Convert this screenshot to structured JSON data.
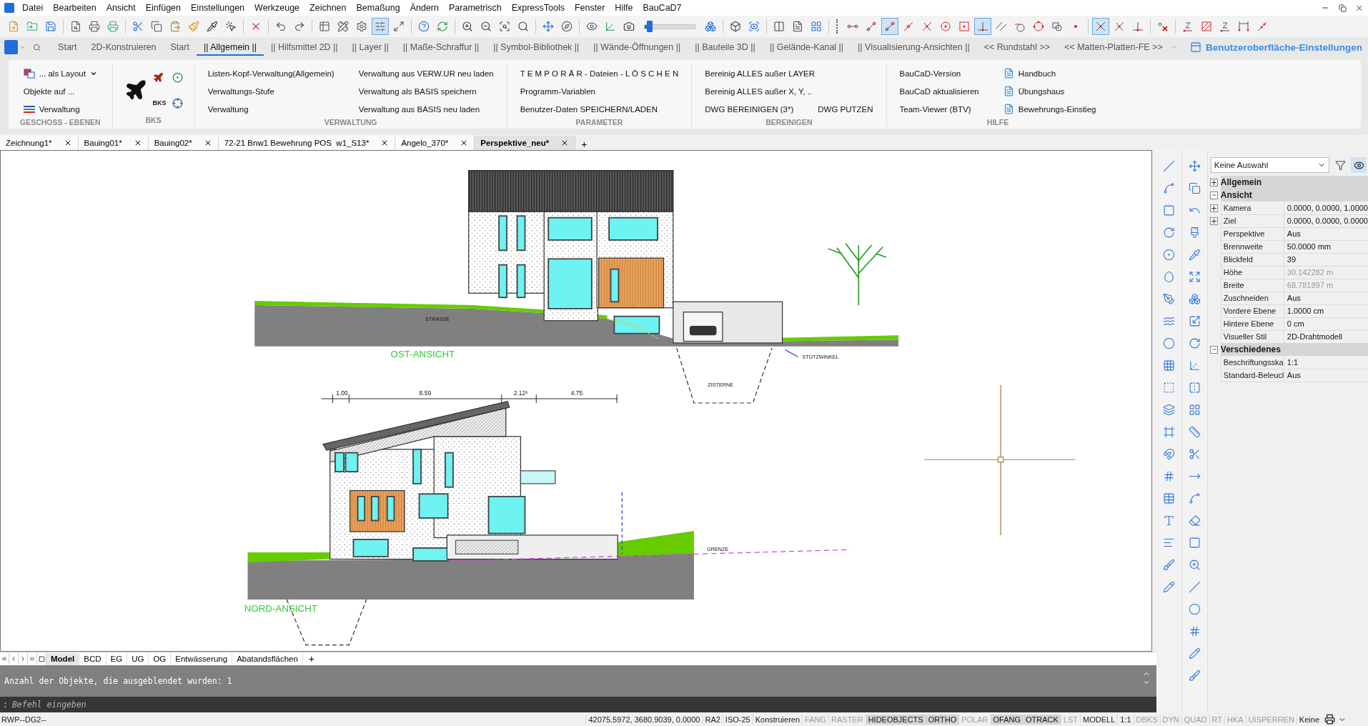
{
  "menu": [
    "Datei",
    "Bearbeiten",
    "Ansicht",
    "Einfügen",
    "Einstellungen",
    "Werkzeuge",
    "Zeichnen",
    "Bemaßung",
    "Ändern",
    "Parametrisch",
    "ExpressTools",
    "Fenster",
    "Hilfe",
    "BauCaD7"
  ],
  "toolbar": {
    "zoom_slider": {
      "level": 0.1
    },
    "buttons": [
      {
        "on": false
      },
      {
        "on": false
      },
      {
        "on": false
      },
      {
        "on": false
      },
      {
        "on": false
      },
      {
        "on": false
      },
      {
        "on": false
      },
      {
        "on": false
      },
      {
        "on": false
      },
      {
        "on": false
      },
      {
        "on": false
      },
      {
        "on": false
      },
      {
        "on": false
      },
      {
        "on": false
      },
      {
        "on": false
      },
      {
        "on": false
      },
      {
        "on": false
      },
      {
        "on": false
      },
      {
        "on": true
      },
      {
        "on": false
      },
      {
        "on": false
      },
      {
        "on": false
      },
      {
        "on": false
      },
      {
        "on": false
      },
      {
        "on": false
      },
      {
        "on": false
      },
      {
        "on": false
      },
      {
        "on": false
      },
      {
        "on": false
      },
      {
        "on": false
      },
      {
        "on": false
      },
      {
        "on": false
      },
      {
        "on": false
      },
      {
        "on": false
      },
      {
        "on": false
      },
      {
        "on": false
      },
      {
        "on": false
      },
      {
        "on": false
      },
      {
        "on": false
      },
      {
        "on": true
      },
      {
        "on": false
      },
      {
        "on": false
      },
      {
        "on": false
      },
      {
        "on": false
      },
      {
        "on": true
      },
      {
        "on": false
      },
      {
        "on": false
      },
      {
        "on": false
      },
      {
        "on": false
      },
      {
        "on": false
      },
      {
        "on": true
      },
      {
        "on": false
      },
      {
        "on": false
      },
      {
        "on": false
      },
      {
        "on": false
      },
      {
        "on": false
      },
      {
        "on": false
      },
      {
        "on": false
      },
      {
        "on": false
      }
    ]
  },
  "ribbon": {
    "tabs": [
      {
        "label": "Start",
        "selected": false
      },
      {
        "label": "2D-Konstruieren",
        "selected": false
      },
      {
        "label": "Start",
        "selected": false
      },
      {
        "label": "|| Allgemein ||",
        "selected": true
      },
      {
        "label": "|| Hilfsmittel 2D ||",
        "selected": false
      },
      {
        "label": "|| Layer ||",
        "selected": false
      },
      {
        "label": "|| Maße-Schraffur ||",
        "selected": false
      },
      {
        "label": "|| Symbol-Bibliothek ||",
        "selected": false
      },
      {
        "label": "|| Wände-Öffnungen ||",
        "selected": false
      },
      {
        "label": "|| Bauteile 3D ||",
        "selected": false
      },
      {
        "label": "|| Gelände-Kanal ||",
        "selected": false
      },
      {
        "label": "|| Visualisierung-Ansichten ||",
        "selected": false
      },
      {
        "label": "<< Rundstahl >>",
        "selected": false
      },
      {
        "label": "<< Matten-Platten-FE >>",
        "selected": false
      }
    ],
    "settings_link": "Benutzeroberfläche-Einstellungen",
    "panels": [
      {
        "title": "GESCHOSS - EBENEN",
        "kind": "buttons",
        "rows": [
          [
            {
              "label": "... als Layout",
              "kind": "layout",
              "dropdown": true
            }
          ],
          [
            {
              "label": "Objekte auf ...",
              "kind": "plain",
              "dropdown": false
            }
          ],
          [
            {
              "label": "Verwaltung",
              "kind": "lines",
              "dropdown": false
            }
          ]
        ]
      },
      {
        "title": "BKS",
        "kind": "icons",
        "caption": "BKS"
      },
      {
        "title": "VERWALTUNG",
        "kind": "buttons",
        "rows": [
          [
            {
              "label": "Listen-Kopf-Verwaltung(Allgemein)"
            },
            {
              "label": "Verwaltung aus VERW.UR neu laden"
            }
          ],
          [
            {
              "label": "Verwaltungs-Stufe"
            },
            {
              "label": "Verwaltung als BASIS speichern"
            }
          ],
          [
            {
              "label": "Verwaltung"
            },
            {
              "label": "Verwaltung aus BASIS neu laden"
            }
          ]
        ]
      },
      {
        "title": "PARAMETER",
        "kind": "buttons",
        "rows": [
          [
            {
              "label": "T E M P O R Ä R - Dateien - L Ö S C H E N"
            }
          ],
          [
            {
              "label": "Programm-Variablen"
            }
          ],
          [
            {
              "label": "Benutzer-Daten SPEICHERN/LADEN"
            }
          ]
        ]
      },
      {
        "title": "BEREINIGEN",
        "kind": "buttons",
        "rows": [
          [
            {
              "label": "Bereinig ALLES außer LAYER"
            }
          ],
          [
            {
              "label": "Bereinig ALLES außer X, Y, .."
            }
          ],
          [
            {
              "label": "DWG BEREINIGEN (3*)"
            },
            {
              "label": "DWG PUTZEN"
            }
          ]
        ]
      },
      {
        "title": "HILFE",
        "kind": "buttons",
        "rows": [
          [
            {
              "label": "BauCaD-Version",
              "kind": "plain"
            },
            {
              "label": "Handbuch",
              "kind": "pdf"
            }
          ],
          [
            {
              "label": "BauCaD aktualisieren",
              "kind": "plain"
            },
            {
              "label": "Übungshaus",
              "kind": "pdf"
            }
          ],
          [
            {
              "label": "Team-Viewer (BTV)",
              "kind": "plain"
            },
            {
              "label": "Bewehrungs-Einstieg",
              "kind": "pdf"
            }
          ]
        ]
      }
    ]
  },
  "documents": {
    "tabs": [
      {
        "label": "Zeichnung1*",
        "selected": false
      },
      {
        "label": "Bauing01*",
        "selected": false
      },
      {
        "label": "Bauing02*",
        "selected": false
      },
      {
        "label": "72-21 Bnw1 Bewehrung POS  w1_S13*",
        "selected": false
      },
      {
        "label": "Angelo_370*",
        "selected": false
      },
      {
        "label": "Perspektive_neu*",
        "selected": true
      }
    ],
    "add": "+"
  },
  "drawing": {
    "labels": [
      {
        "text": "OST-ANSICHT",
        "kind": "title"
      },
      {
        "text": "NORD-ANSICHT",
        "kind": "title"
      },
      {
        "text": "1.00",
        "kind": "dimension"
      },
      {
        "text": "8.59",
        "kind": "dimension"
      },
      {
        "text": "2.12⁵",
        "kind": "dimension"
      },
      {
        "text": "4.75",
        "kind": "dimension"
      },
      {
        "text": "STRASSE",
        "kind": "note"
      },
      {
        "text": "ZISTERNE",
        "kind": "note"
      },
      {
        "text": "STÜTZWINKEL",
        "kind": "note"
      },
      {
        "text": "GRENZE",
        "kind": "note"
      }
    ]
  },
  "layouts": {
    "tabs": [
      {
        "label": "Model",
        "selected": true
      },
      {
        "label": "BCD",
        "selected": false
      },
      {
        "label": "EG",
        "selected": false
      },
      {
        "label": "UG",
        "selected": false
      },
      {
        "label": "OG",
        "selected": false
      },
      {
        "label": "Entwässerung",
        "selected": false
      },
      {
        "label": "Abatandsflächen",
        "selected": false
      }
    ],
    "add": "+"
  },
  "command": {
    "history": "Anzahl der Objekte, die ausgeblendet wurden: 1",
    "prompt": ":",
    "placeholder": "Befehl eingeben"
  },
  "properties": {
    "selection": "Keine Auswahl",
    "sections": [
      {
        "title": "Allgemein",
        "expanded": false
      },
      {
        "title": "Ansicht",
        "expanded": true,
        "rows": [
          {
            "label": "Kamera",
            "value": "0.0000, 0.0000, 1.0000",
            "kind": "expandable",
            "expanded": false,
            "disabled": false
          },
          {
            "label": "Ziel",
            "value": "0.0000, 0.0000, 0.0000",
            "kind": "expandable",
            "expanded": false,
            "disabled": false
          },
          {
            "label": "Perspektive",
            "value": "Aus",
            "kind": "plain",
            "disabled": false
          },
          {
            "label": "Brennweite",
            "value": "50.0000 mm",
            "kind": "plain",
            "disabled": false
          },
          {
            "label": "Blickfeld",
            "value": "39",
            "kind": "plain",
            "disabled": false
          },
          {
            "label": "Höhe",
            "value": "30.142282 m",
            "kind": "plain",
            "disabled": true
          },
          {
            "label": "Breite",
            "value": "68.781897 m",
            "kind": "plain",
            "disabled": true
          },
          {
            "label": "Zuschneiden",
            "value": "Aus",
            "kind": "plain",
            "disabled": false
          },
          {
            "label": "Vordere Ebene",
            "value": "1.0000 cm",
            "kind": "plain",
            "disabled": false
          },
          {
            "label": "Hintere Ebene",
            "value": "0 cm",
            "kind": "plain",
            "disabled": false
          },
          {
            "label": "Visueller Stil",
            "value": "2D-Drahtmodell",
            "kind": "plain",
            "disabled": false
          }
        ]
      },
      {
        "title": "Verschiedenes",
        "expanded": true,
        "rows": [
          {
            "label": "Beschriftungsska",
            "value": "1:1",
            "kind": "plain",
            "disabled": false
          },
          {
            "label": "Standard-Beleucl",
            "value": "Aus",
            "kind": "plain",
            "disabled": false
          }
        ]
      }
    ]
  },
  "status_bar": {
    "left": "RWP--DG2--",
    "items": [
      {
        "label": "42075.5972, 3680.9039, 0.0000",
        "kind": "text"
      },
      {
        "label": "RA2",
        "kind": "text"
      },
      {
        "label": "ISO-25",
        "kind": "text"
      },
      {
        "label": "Konstruieren",
        "kind": "text"
      },
      {
        "label": "FANG",
        "kind": "toggle",
        "on": false
      },
      {
        "label": "RASTER",
        "kind": "toggle",
        "on": false
      },
      {
        "label": "HIDEOBJECTS",
        "kind": "toggle",
        "on": true
      },
      {
        "label": "ORTHO",
        "kind": "toggle",
        "on": true
      },
      {
        "label": "POLAR",
        "kind": "toggle",
        "on": false
      },
      {
        "label": "OFANG",
        "kind": "toggle",
        "on": true
      },
      {
        "label": "OTRACK",
        "kind": "toggle",
        "on": true
      },
      {
        "label": "LST",
        "kind": "toggle",
        "on": false
      },
      {
        "label": "MODELL",
        "kind": "text"
      },
      {
        "label": "1:1",
        "kind": "text"
      },
      {
        "label": "DBKS",
        "kind": "toggle",
        "on": false
      },
      {
        "label": "DYN",
        "kind": "toggle",
        "on": false
      },
      {
        "label": "QUAD",
        "kind": "toggle",
        "on": false
      },
      {
        "label": "RT",
        "kind": "toggle",
        "on": false
      },
      {
        "label": "HKA",
        "kind": "toggle",
        "on": false
      },
      {
        "label": "UISPERREN",
        "kind": "toggle",
        "on": false
      },
      {
        "label": "Keine",
        "kind": "text"
      }
    ]
  }
}
